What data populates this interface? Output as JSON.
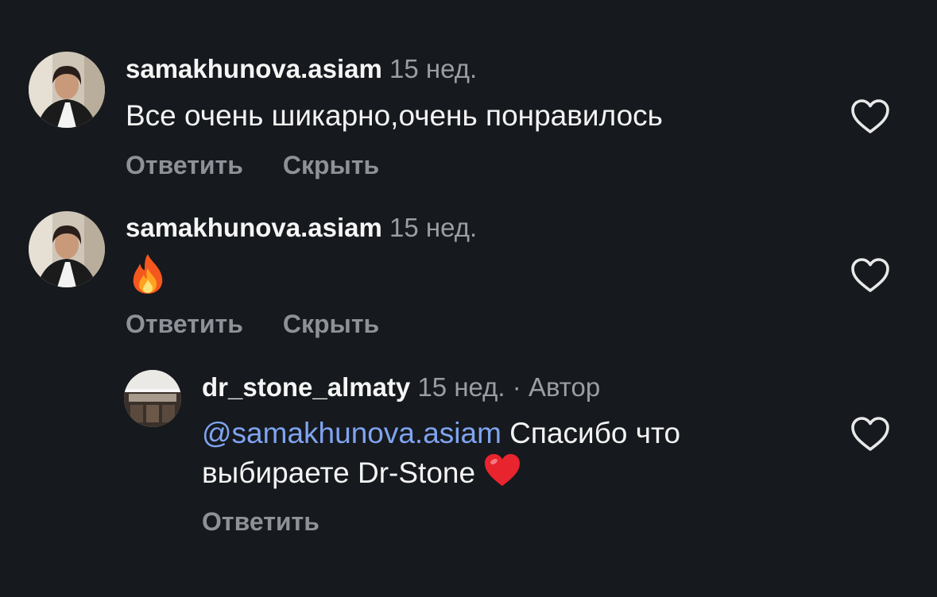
{
  "comments": [
    {
      "username": "samakhunova.asiam",
      "time": "15 нед.",
      "text": "Все очень шикарно,очень понравилось",
      "reply_label": "Ответить",
      "hide_label": "Скрыть"
    },
    {
      "username": "samakhunova.asiam",
      "time": "15 нед.",
      "emoji": "fire",
      "reply_label": "Ответить",
      "hide_label": "Скрыть"
    }
  ],
  "reply": {
    "username": "dr_stone_almaty",
    "time": "15 нед.",
    "dot": "·",
    "author_label": "Автор",
    "mention": "@samakhunova.asiam",
    "text_line1_rest": " Спасибо что",
    "text_line2": "выбираете Dr-Stone",
    "emoji": "red-heart",
    "reply_label": "Ответить"
  },
  "icons": {
    "like": "heart-outline-icon"
  },
  "colors": {
    "background": "#16191d",
    "mention": "#7fa4f0",
    "muted": "#9a9ea4"
  }
}
